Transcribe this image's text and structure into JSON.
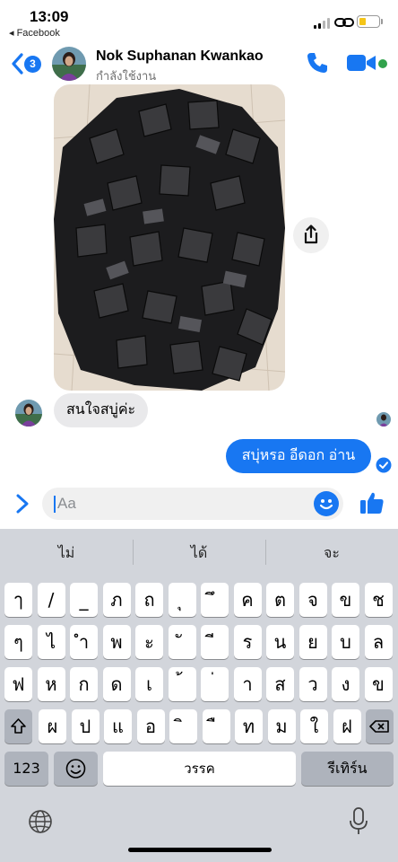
{
  "status_bar": {
    "time": "13:09",
    "back_app": "◂ Facebook"
  },
  "header": {
    "unread_count": "3",
    "contact_name": "Nok Suphanan Kwankao",
    "contact_status": "กำลังใช้งาน"
  },
  "messages": {
    "incoming_text": "สนใจสบู่ค่ะ",
    "outgoing_text": "สบุ่หรอ อีดอก อ่าน"
  },
  "composer": {
    "placeholder": "Aa"
  },
  "keyboard": {
    "suggestions": [
      "ไม่",
      "ได้",
      "จะ"
    ],
    "row1": [
      "ๅ",
      "/",
      "_",
      "ภ",
      "ถ",
      "ุ",
      "ึ",
      "ค",
      "ต",
      "จ",
      "ข",
      "ช"
    ],
    "row2": [
      "ๆ",
      "ไ",
      "ำ",
      "พ",
      "ะ",
      "ั",
      "ี",
      "ร",
      "น",
      "ย",
      "บ",
      "ล"
    ],
    "row3": [
      "ฟ",
      "ห",
      "ก",
      "ด",
      "เ",
      "้",
      "่",
      "า",
      "ส",
      "ว",
      "ง",
      "ข"
    ],
    "row4": [
      "ผ",
      "ป",
      "แ",
      "อ",
      "ิ",
      "ื",
      "ท",
      "ม",
      "ใ",
      "ฝ"
    ],
    "numbers_key": "123",
    "space_key": "วรรค",
    "return_key": "รีเทิร์น"
  },
  "colors": {
    "accent": "#1877f2",
    "online": "#31a24c",
    "keyboard_bg": "#d2d5db"
  }
}
